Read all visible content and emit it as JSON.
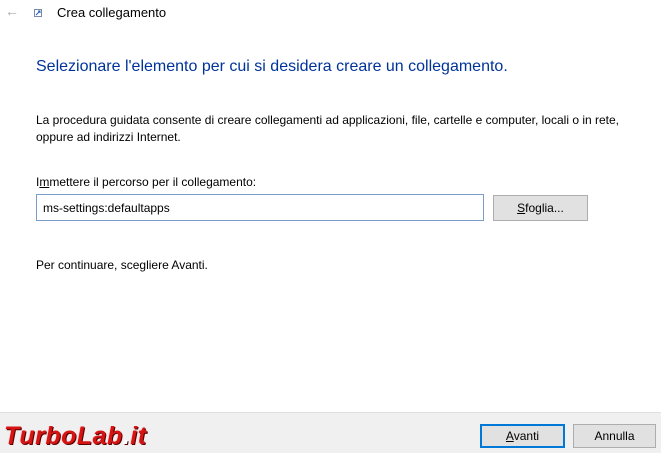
{
  "window": {
    "title": "Crea collegamento",
    "back_icon": "back-arrow-icon",
    "app_icon": "shortcut-icon"
  },
  "heading": "Selezionare l'elemento per cui si desidera creare un collegamento.",
  "description": "La procedura guidata consente di creare collegamenti ad applicazioni, file, cartelle e computer, locali o in rete, oppure ad indirizzi Internet.",
  "path_field": {
    "label_prefix": "I",
    "label_accel": "m",
    "label_rest": "mettere il percorso per il collegamento:",
    "value": "ms-settings:defaultapps"
  },
  "browse_button": {
    "accel": "S",
    "rest": "foglia..."
  },
  "continue_text": "Per continuare, scegliere Avanti.",
  "footer": {
    "next_accel": "A",
    "next_rest": "vanti",
    "cancel_label": "Annulla"
  },
  "watermark": {
    "part1": "TurboLab",
    "part2": ".",
    "part3": "it"
  },
  "colors": {
    "heading": "#003399",
    "focus_border": "#0078d7",
    "watermark": "#d71414"
  }
}
